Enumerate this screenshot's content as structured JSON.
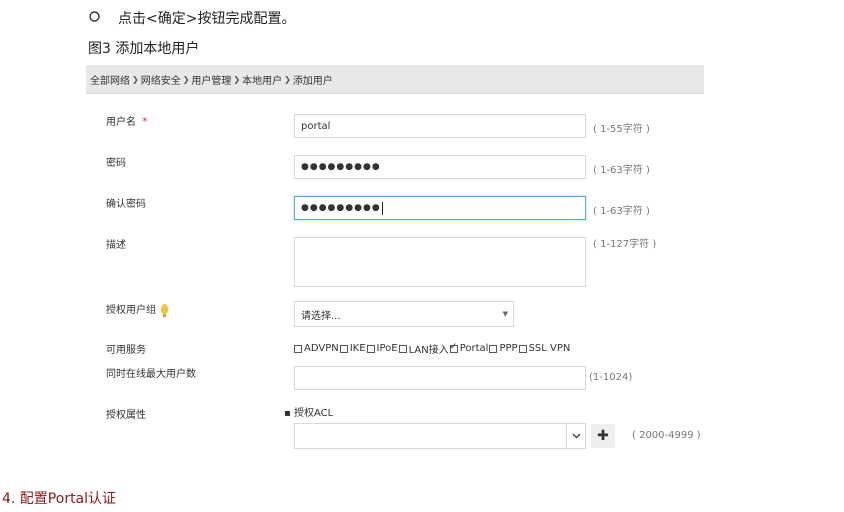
{
  "doc": {
    "step_text": "点击<确定>按钮完成配置。",
    "figure_title": "图3 添加本地用户",
    "section_heading": "4. 配置Portal认证"
  },
  "breadcrumb": [
    "全部网络",
    "网络安全",
    "用户管理",
    "本地用户",
    "添加用户"
  ],
  "form": {
    "username": {
      "label": "用户名",
      "required_mark": "*",
      "value": "portal",
      "hint": "( 1-55字符 )"
    },
    "password": {
      "label": "密码",
      "value": "●●●●●●●●●",
      "hint": "( 1-63字符 )"
    },
    "confirm_password": {
      "label": "确认密码",
      "value": "●●●●●●●●●",
      "hint": "( 1-63字符 )"
    },
    "description": {
      "label": "描述",
      "value": "",
      "hint": "( 1-127字符 )"
    },
    "group": {
      "label": "授权用户组",
      "selected": "请选择..."
    },
    "services": {
      "label": "可用服务",
      "options": [
        {
          "label": "ADVPN",
          "checked": false
        },
        {
          "label": "IKE",
          "checked": false
        },
        {
          "label": "IPoE",
          "checked": false
        },
        {
          "label": "LAN接入",
          "checked": false
        },
        {
          "label": "Portal",
          "checked": true
        },
        {
          "label": "PPP",
          "checked": false
        },
        {
          "label": "SSL VPN",
          "checked": false
        }
      ]
    },
    "max_online": {
      "label": "同时在线最大用户数",
      "value": "",
      "hint": "(1-1024)"
    },
    "auth_attr": {
      "label": "授权属性",
      "acl_label": "授权ACL",
      "acl_value": "",
      "hint": "( 2000-4999 )"
    }
  },
  "icons": {
    "bullet": "circle-outline-icon",
    "breadcrumb_sep": "chevron-right-icon",
    "group_tip": "lightbulb-icon",
    "acl_dropdown": "chevron-down-icon",
    "acl_add": "plus-icon"
  },
  "colors": {
    "section_heading": "#8b1a1a",
    "required": "#e53935",
    "focus_border": "#5aa9e6",
    "breadcrumb_bg": "#e8e8e8"
  }
}
